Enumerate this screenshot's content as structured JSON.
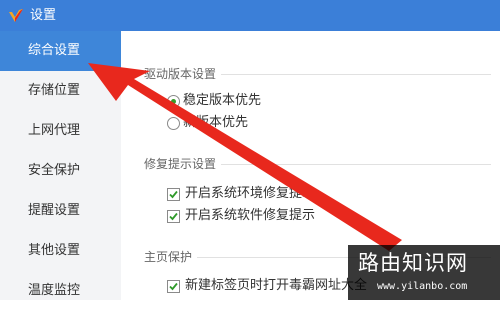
{
  "window": {
    "title": "设置",
    "logo_icon": "app-logo-icon",
    "accent": "#3b7fd8"
  },
  "sidebar": {
    "items": [
      {
        "label": "综合设置",
        "active": true
      },
      {
        "label": "存储位置"
      },
      {
        "label": "上网代理"
      },
      {
        "label": "安全保护"
      },
      {
        "label": "提醒设置"
      },
      {
        "label": "其他设置"
      },
      {
        "label": "温度监控"
      }
    ]
  },
  "sections": {
    "driver": {
      "title": "驱动版本设置",
      "options": [
        {
          "label": "稳定版本优先",
          "selected": true
        },
        {
          "label": "新版本优先",
          "selected": false
        }
      ]
    },
    "repair": {
      "title": "修复提示设置",
      "options": [
        {
          "label": "开启系统环境修复提示",
          "checked": true
        },
        {
          "label": "开启系统软件修复提示",
          "checked": true
        }
      ]
    },
    "homepage": {
      "title": "主页保护",
      "options": [
        {
          "label": "新建标签页时打开毒霸网址大全",
          "checked": true
        }
      ]
    }
  },
  "annotation": {
    "arrow_color": "#e8281d"
  },
  "watermark": {
    "main": "路由知识网",
    "url": "www.yilanbo.com"
  }
}
